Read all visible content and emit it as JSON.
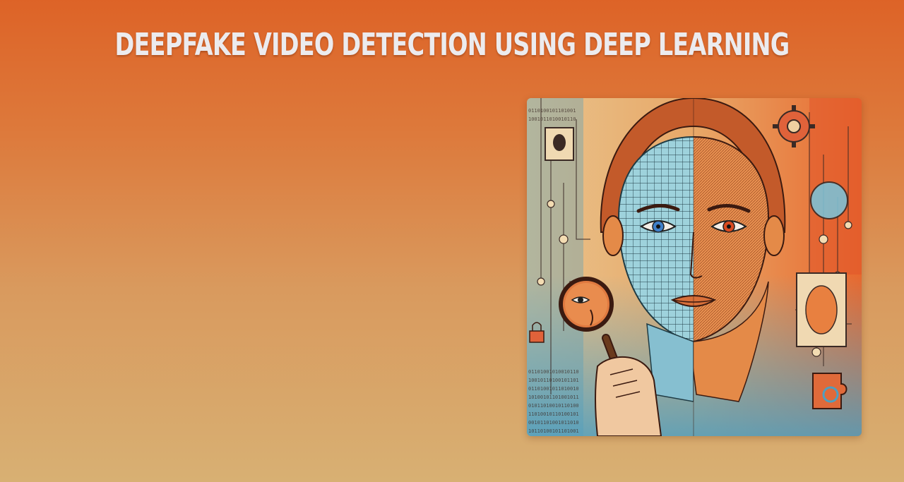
{
  "slide": {
    "title": "DEEPFAKE VIDEO DETECTION USING DEEP LEARNING"
  },
  "illustration": {
    "subject": "split-face-with-magnifying-glass",
    "palette": {
      "orange": "#e0642a",
      "teal": "#4e9fc0",
      "cream": "#efd2a0",
      "dark": "#3b1a10"
    }
  }
}
